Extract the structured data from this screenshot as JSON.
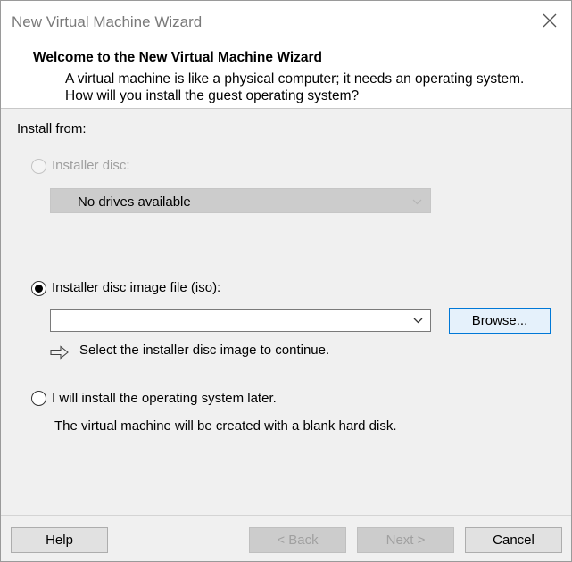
{
  "window": {
    "title": "New Virtual Machine Wizard"
  },
  "header": {
    "title": "Welcome to the New Virtual Machine Wizard",
    "description": "A virtual machine is like a physical computer; it needs an operating system. How will you install the guest operating system?"
  },
  "install_from": {
    "label": "Install from:",
    "options": {
      "installer_disc": {
        "label": "Installer disc:",
        "selected": false,
        "enabled": false,
        "dropdown_value": "No drives available"
      },
      "iso": {
        "label": "Installer disc image file (iso):",
        "selected": true,
        "path_value": "",
        "browse_label": "Browse...",
        "hint_icon": "arrow-right-icon",
        "hint": "Select the installer disc image to continue."
      },
      "later": {
        "label": "I will install the operating system later.",
        "selected": false,
        "description": "The virtual machine will be created with a blank hard disk."
      }
    }
  },
  "footer": {
    "help": "Help",
    "back": "< Back",
    "next": "Next >",
    "cancel": "Cancel"
  },
  "colors": {
    "focus_border": "#0078d7",
    "focus_bg": "#e5f1fb",
    "disabled_text": "#9f9f9f"
  }
}
